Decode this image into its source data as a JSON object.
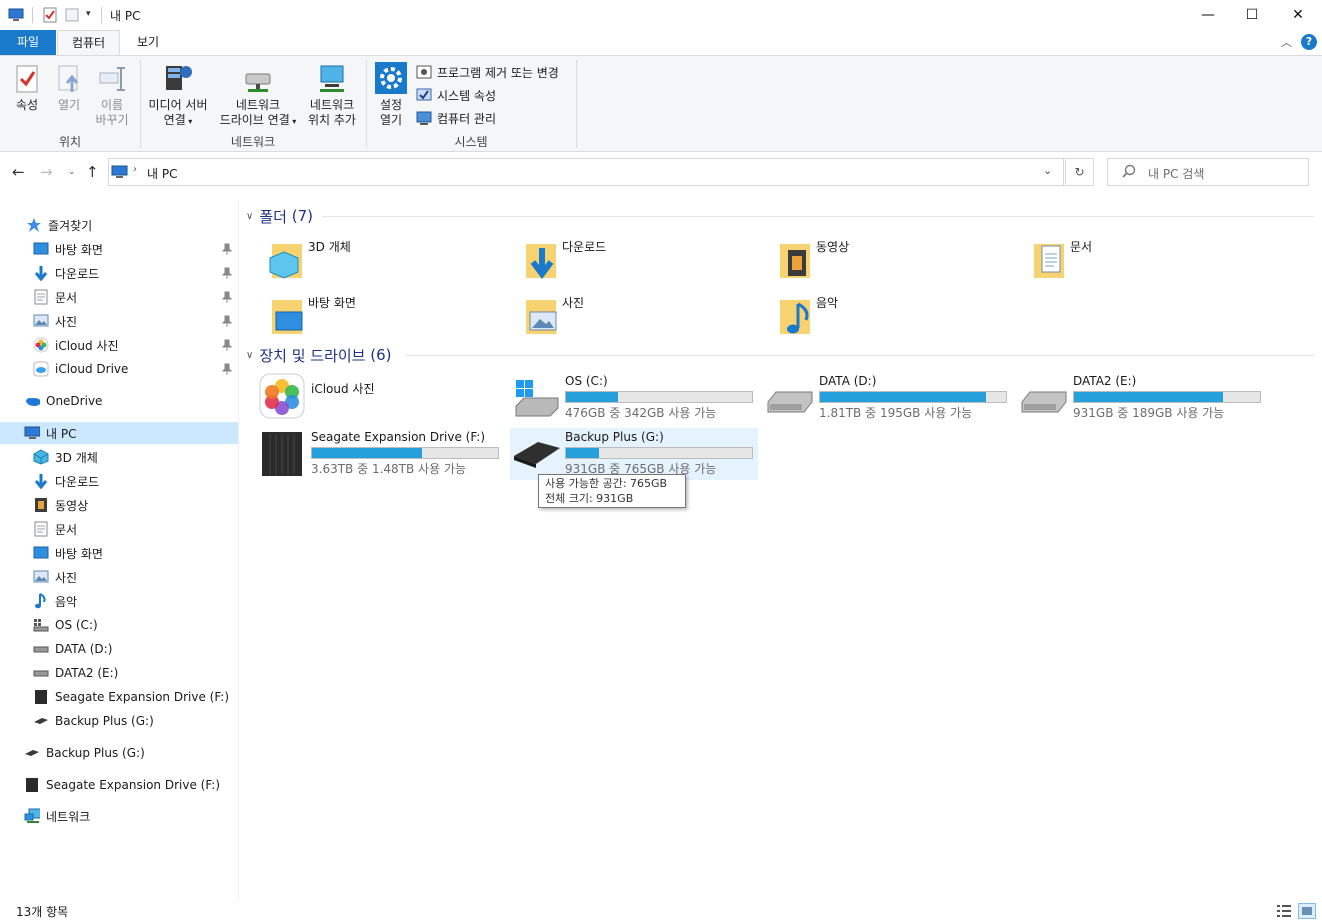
{
  "window": {
    "title": "내 PC",
    "controls": {
      "minimize": "—",
      "maximize": "☐",
      "close": "✕"
    }
  },
  "ribbon_tabs": [
    "파일",
    "컴퓨터",
    "보기"
  ],
  "ribbon": {
    "location_group": {
      "label": "위치",
      "properties": "속성",
      "open": "열기",
      "rename_line1": "이름",
      "rename_line2": "바꾸기"
    },
    "network_group": {
      "label": "네트워크",
      "media_line1": "미디어 서버",
      "media_line2": "연결",
      "map_line1": "네트워크",
      "map_line2": "드라이브 연결",
      "add_line1": "네트워크",
      "add_line2": "위치 추가"
    },
    "system_group": {
      "label": "시스템",
      "settings_line1": "설정",
      "settings_line2": "열기",
      "uninstall": "프로그램 제거 또는 변경",
      "system_props": "시스템 속성",
      "manage": "컴퓨터 관리"
    }
  },
  "address": {
    "path": "내 PC",
    "search_placeholder": "내 PC 검색"
  },
  "nav": {
    "quick_access": "즐겨찾기",
    "quick_items": [
      "바탕 화면",
      "다운로드",
      "문서",
      "사진",
      "iCloud 사진",
      "iCloud Drive"
    ],
    "onedrive": "OneDrive",
    "this_pc": "내 PC",
    "pc_items": [
      "3D 개체",
      "다운로드",
      "동영상",
      "문서",
      "바탕 화면",
      "사진",
      "음악",
      "OS (C:)",
      "DATA (D:)",
      "DATA2 (E:)",
      "Seagate Expansion Drive (F:)",
      "Backup Plus (G:)"
    ],
    "backup": "Backup Plus (G:)",
    "seagate": "Seagate Expansion Drive (F:)",
    "network": "네트워크"
  },
  "folders_group": {
    "title": "폴더",
    "count": "(7)"
  },
  "folders": [
    "3D 개체",
    "다운로드",
    "동영상",
    "문서",
    "바탕 화면",
    "사진",
    "음악"
  ],
  "drives_group": {
    "title": "장치 및 드라이브",
    "count": "(6)"
  },
  "drives": [
    {
      "name": "iCloud 사진",
      "free_text": "",
      "used_fraction": null
    },
    {
      "name": "OS (C:)",
      "free_text": "476GB 중 342GB 사용 가능",
      "used_fraction": 0.28
    },
    {
      "name": "DATA (D:)",
      "free_text": "1.81TB 중 195GB 사용 가능",
      "used_fraction": 0.89
    },
    {
      "name": "DATA2 (E:)",
      "free_text": "931GB 중 189GB 사용 가능",
      "used_fraction": 0.8
    },
    {
      "name": "Seagate Expansion Drive (F:)",
      "free_text": "3.63TB 중 1.48TB 사용 가능",
      "used_fraction": 0.59
    },
    {
      "name": "Backup Plus (G:)",
      "free_text": "931GB 중 765GB 사용 가능",
      "used_fraction": 0.18
    }
  ],
  "tooltip": {
    "line1": "사용 가능한 공간: 765GB",
    "line2": "전체 크기: 931GB"
  },
  "status": {
    "item_count": "13개 항목"
  },
  "colors": {
    "accent": "#1979ca",
    "bar_fill": "#26a0da",
    "selection": "#cce8ff",
    "hover": "#e5f3ff",
    "group_header": "#1e3287"
  }
}
